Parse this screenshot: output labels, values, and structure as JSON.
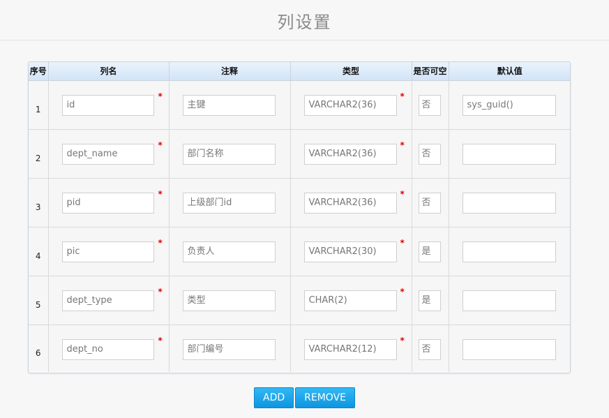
{
  "page": {
    "title": "列设置"
  },
  "table": {
    "headers": {
      "seq": "序号",
      "name": "列名",
      "comment": "注释",
      "type": "类型",
      "nullable": "是否可空",
      "default": "默认值"
    },
    "required_mark": "*",
    "rows": [
      {
        "seq": "1",
        "name": "id",
        "comment": "主键",
        "type": "VARCHAR2(36)",
        "nullable": "否",
        "default": "sys_guid()"
      },
      {
        "seq": "2",
        "name": "dept_name",
        "comment": "部门名称",
        "type": "VARCHAR2(36)",
        "nullable": "否",
        "default": ""
      },
      {
        "seq": "3",
        "name": "pid",
        "comment": "上级部门id",
        "type": "VARCHAR2(36)",
        "nullable": "否",
        "default": ""
      },
      {
        "seq": "4",
        "name": "pic",
        "comment": "负责人",
        "type": "VARCHAR2(30)",
        "nullable": "是",
        "default": ""
      },
      {
        "seq": "5",
        "name": "dept_type",
        "comment": "类型",
        "type": "CHAR(2)",
        "nullable": "是",
        "default": ""
      },
      {
        "seq": "6",
        "name": "dept_no",
        "comment": "部门编号",
        "type": "VARCHAR2(12)",
        "nullable": "否",
        "default": ""
      }
    ]
  },
  "buttons": {
    "add_label": "ADD",
    "remove_label": "REMOVE"
  },
  "colors": {
    "accent": "#1aa7ec",
    "required": "#e00000",
    "header_bg": "#dbe9f8"
  }
}
